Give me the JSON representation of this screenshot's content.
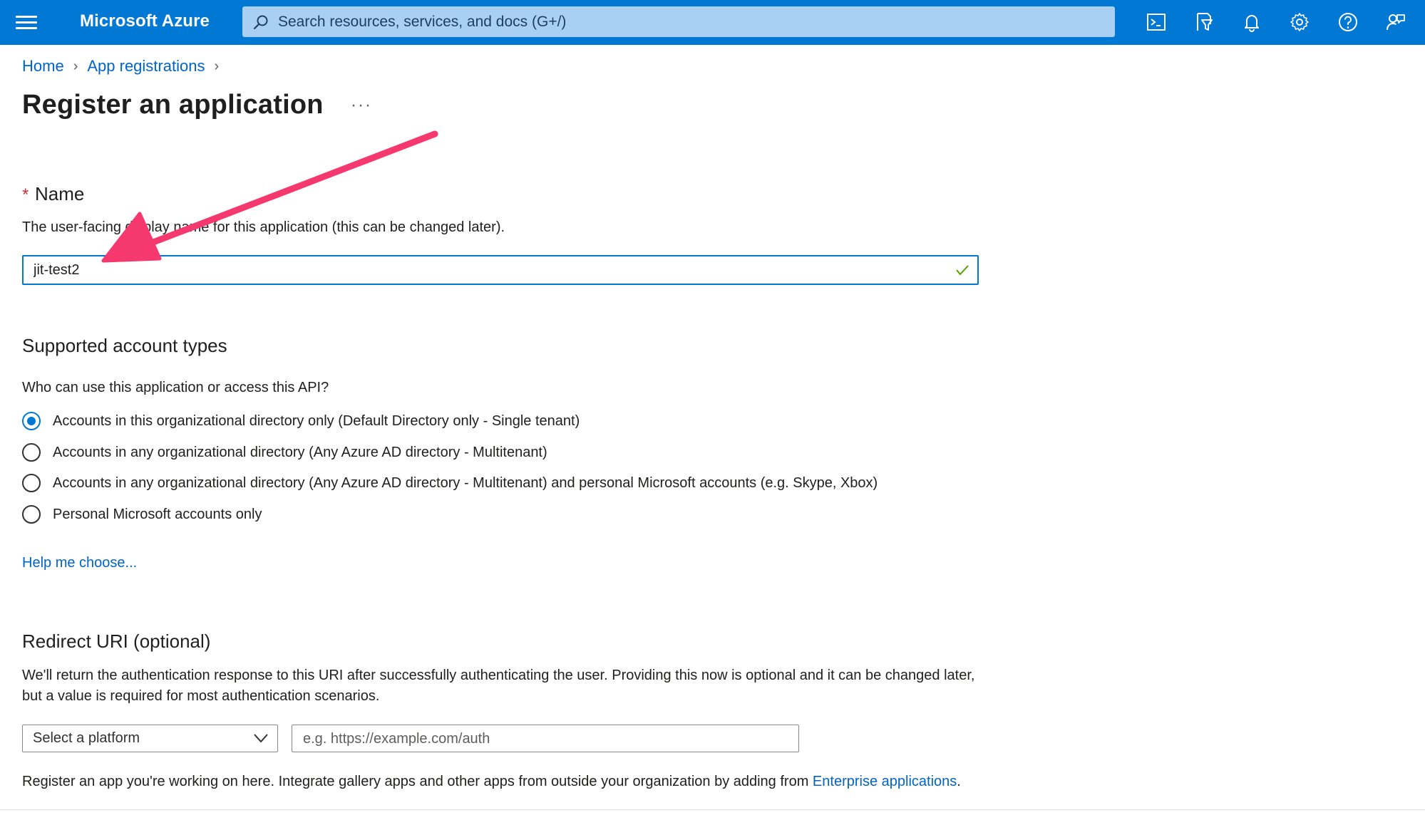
{
  "topbar": {
    "brand": "Microsoft Azure",
    "search_placeholder": "Search resources, services, and docs (G+/)",
    "icons": [
      "cloud-shell-icon",
      "directory-filter-icon",
      "notifications-bell-icon",
      "settings-gear-icon",
      "help-question-icon",
      "feedback-icon"
    ],
    "color": "#0078d4"
  },
  "breadcrumb": {
    "items": [
      "Home",
      "App registrations"
    ],
    "separator": ">"
  },
  "page": {
    "title": "Register an application",
    "more": "···"
  },
  "name_section": {
    "required_marker": "*",
    "label": "Name",
    "description": "The user-facing display name for this application (this can be changed later).",
    "value": "jit-test2"
  },
  "account_types": {
    "heading": "Supported account types",
    "question": "Who can use this application or access this API?",
    "options": [
      {
        "label": "Accounts in this organizational directory only (Default Directory only - Single tenant)",
        "selected": true
      },
      {
        "label": "Accounts in any organizational directory (Any Azure AD directory - Multitenant)",
        "selected": false
      },
      {
        "label": "Accounts in any organizational directory (Any Azure AD directory - Multitenant) and personal Microsoft accounts (e.g. Skype, Xbox)",
        "selected": false
      },
      {
        "label": "Personal Microsoft accounts only",
        "selected": false
      }
    ],
    "help_link": "Help me choose..."
  },
  "redirect": {
    "heading": "Redirect URI (optional)",
    "description": "We'll return the authentication response to this URI after successfully authenticating the user. Providing this now is optional and it can be changed later, but a value is required for most authentication scenarios.",
    "platform_select": "Select a platform",
    "uri_placeholder": "e.g. https://example.com/auth"
  },
  "footer": {
    "text_before_link": "Register an app you're working on here. Integrate gallery apps and other apps from outside your organization by adding from ",
    "link": "Enterprise applications",
    "text_after_link": "."
  },
  "annotation": {
    "color": "#f5386e",
    "icon": "pointer-arrow"
  }
}
